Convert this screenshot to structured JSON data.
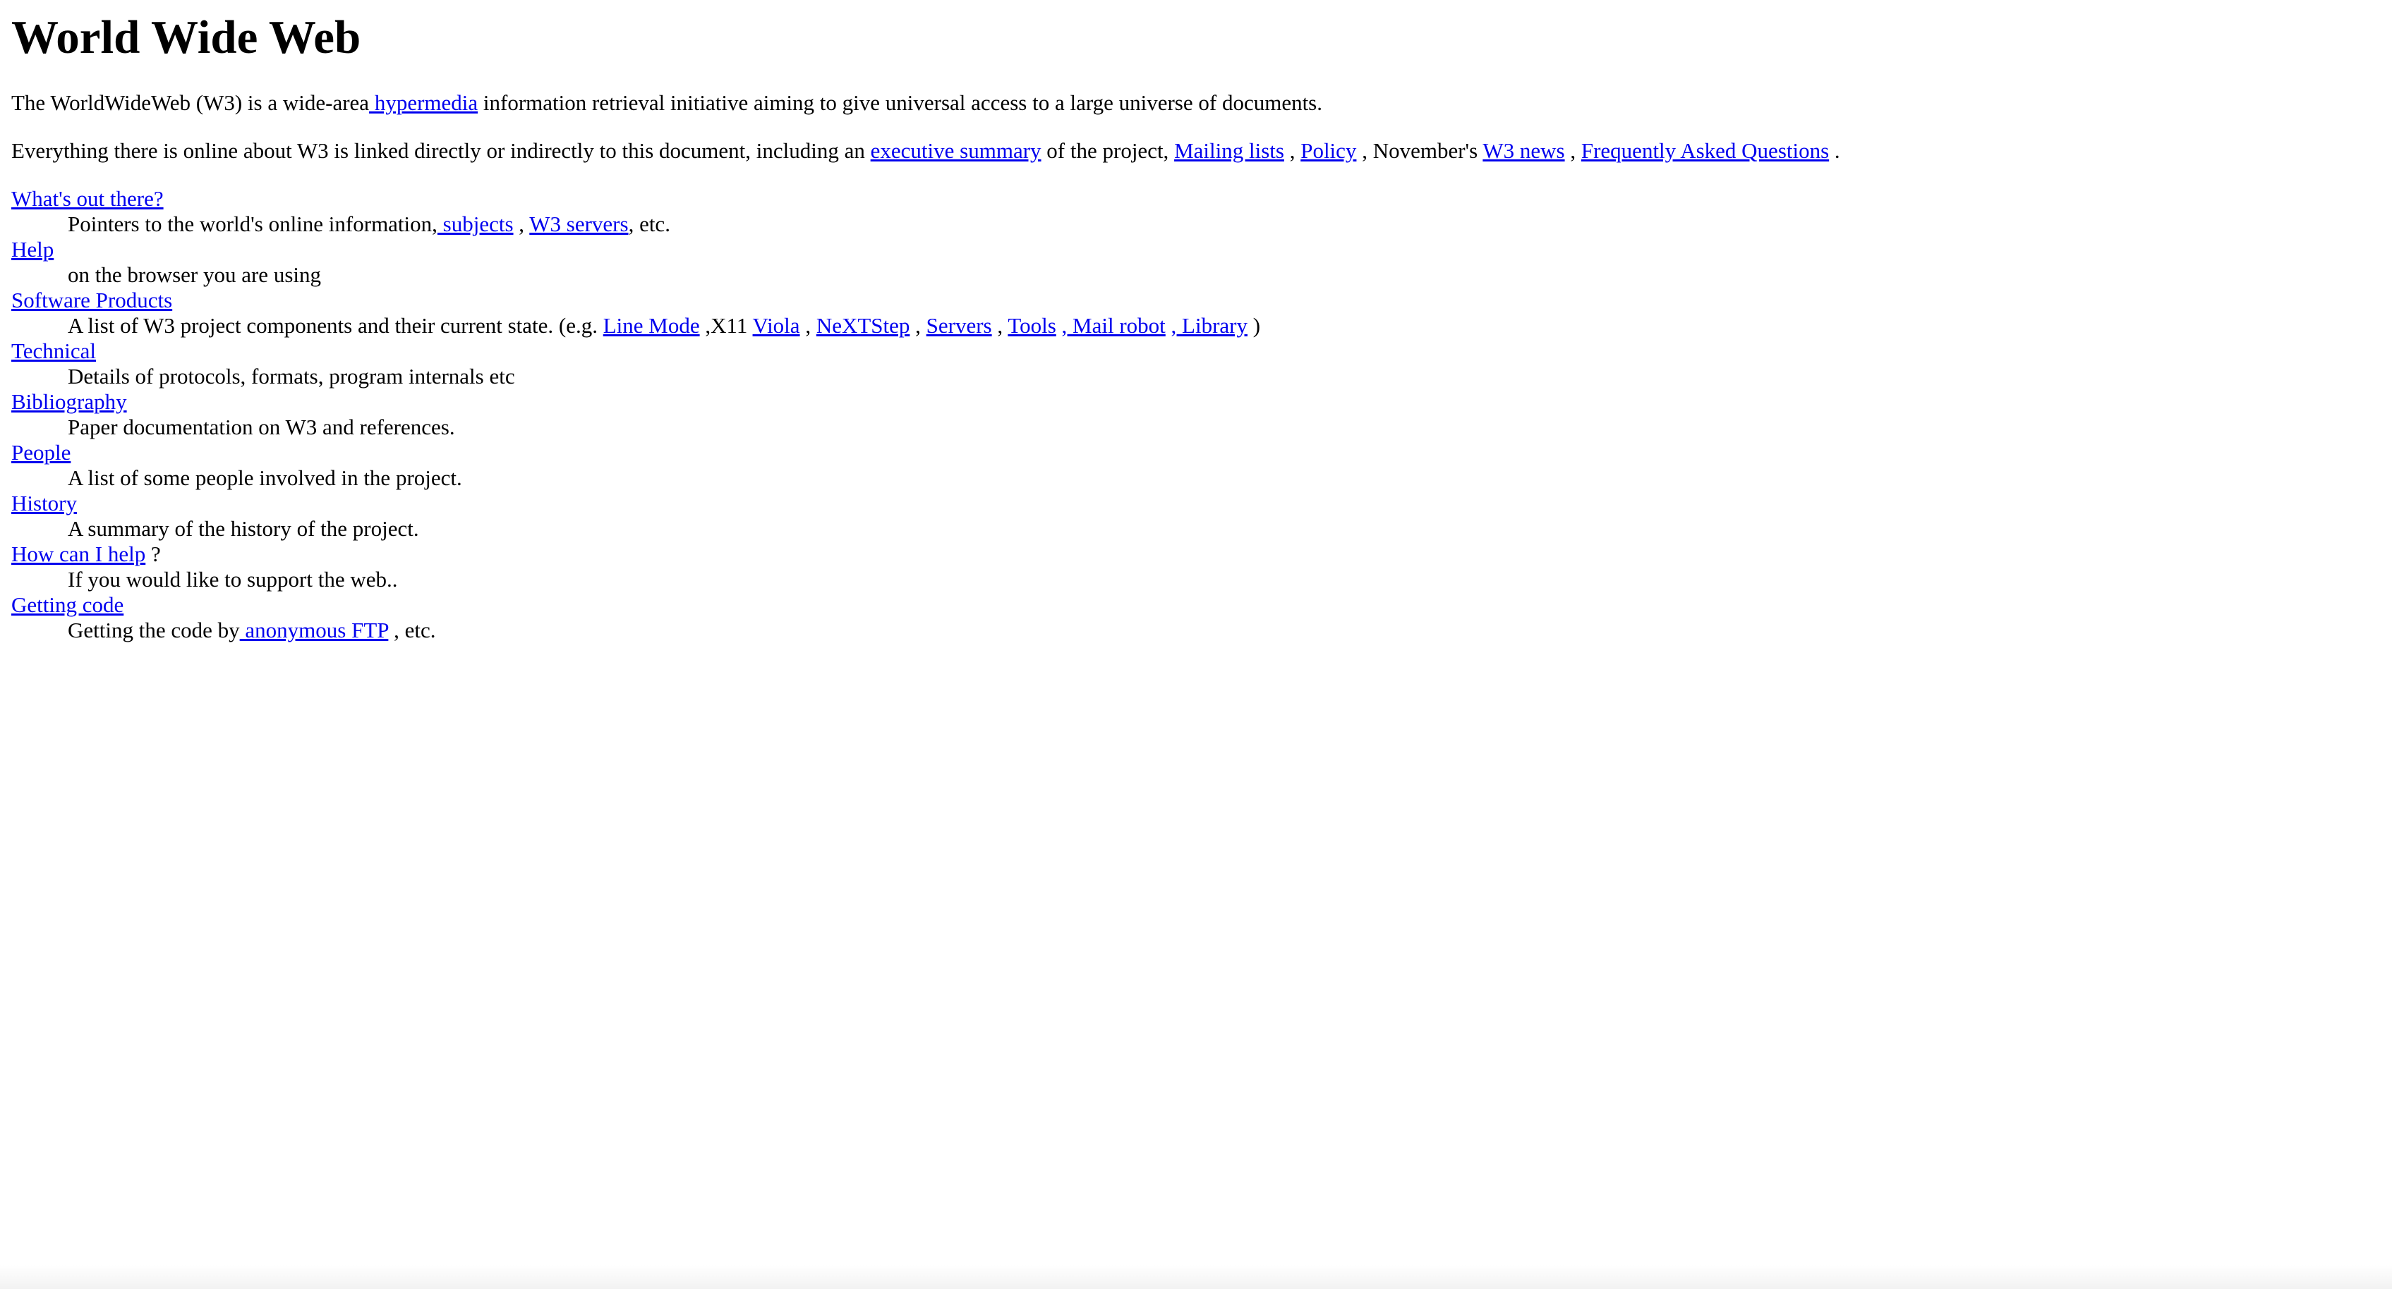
{
  "title": "World Wide Web",
  "intro": {
    "t1": "The WorldWideWeb (W3) is a wide-area",
    "link_hypermedia": " hypermedia",
    "t2": " information retrieval initiative aiming to give universal access to a large universe of documents."
  },
  "para2": {
    "t1": "Everything there is online about W3 is linked directly or indirectly to this document, including an ",
    "link_exec_summary": "executive summary",
    "t2": " of the project, ",
    "link_mailing_lists": "Mailing lists",
    "t3": " , ",
    "link_policy": "Policy",
    "t4": " , November's ",
    "link_w3_news": "W3 news",
    "t5": " , ",
    "link_faq": "Frequently Asked Questions",
    "t6": " ."
  },
  "items": {
    "whats_out_there": {
      "term": "What's out there?",
      "d1": "Pointers to the world's online information,",
      "link_subjects": " subjects",
      "d2": " , ",
      "link_w3_servers": "W3 servers",
      "d3": ", etc."
    },
    "help": {
      "term": "Help",
      "desc": "on the browser you are using"
    },
    "software_products": {
      "term": "Software Products",
      "d1": "A list of W3 project components and their current state. (e.g. ",
      "link_line_mode": "Line Mode",
      "d2": " ,X11 ",
      "link_viola": "Viola",
      "d3": " , ",
      "link_nextstep": "NeXTStep",
      "d4": " , ",
      "link_servers": "Servers",
      "d5": " , ",
      "link_tools": "Tools",
      "d6": " ",
      "link_mail_robot": ", Mail robot",
      "d7": " ",
      "link_library": ", Library",
      "d8": " )"
    },
    "technical": {
      "term": "Technical",
      "desc": "Details of protocols, formats, program internals etc"
    },
    "bibliography": {
      "term": "Bibliography",
      "desc": "Paper documentation on W3 and references."
    },
    "people": {
      "term": "People",
      "desc": "A list of some people involved in the project."
    },
    "history": {
      "term": "History",
      "desc": "A summary of the history of the project."
    },
    "how_can_i_help": {
      "term": "How can I help",
      "term_suffix": " ?",
      "desc": "If you would like to support the web.."
    },
    "getting_code": {
      "term": "Getting code",
      "d1": "Getting the code by",
      "link_anon_ftp": " anonymous FTP",
      "d2": " , etc."
    }
  },
  "colors": {
    "link": "#0000ee",
    "text": "#000000",
    "background": "#ffffff"
  }
}
